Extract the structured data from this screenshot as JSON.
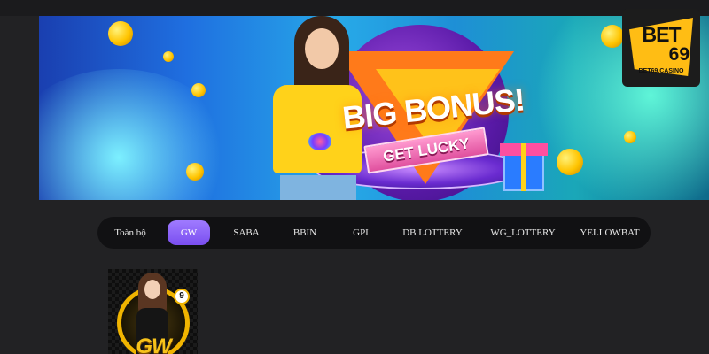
{
  "banner": {
    "headline": "BIG BONUS!",
    "ribbon": "GET LUCKY"
  },
  "logo": {
    "brand": "BET",
    "number": "69",
    "domain": "BET69.CASINO"
  },
  "tabs": [
    {
      "label": "Toàn bộ",
      "active": false
    },
    {
      "label": "GW",
      "active": true
    },
    {
      "label": "SABA",
      "active": false
    },
    {
      "label": "BBIN",
      "active": false
    },
    {
      "label": "GPI",
      "active": false
    },
    {
      "label": "DB LOTTERY",
      "active": false
    },
    {
      "label": "WG_LOTTERY",
      "active": false
    },
    {
      "label": "YELLOWBAT",
      "active": false
    }
  ],
  "game_card": {
    "logo_text": "GW",
    "ball_number": "9"
  },
  "colors": {
    "background": "#222224",
    "tab_bar": "#111113",
    "active_tab": "#8a5cff",
    "brand_yellow": "#ffbd14"
  }
}
